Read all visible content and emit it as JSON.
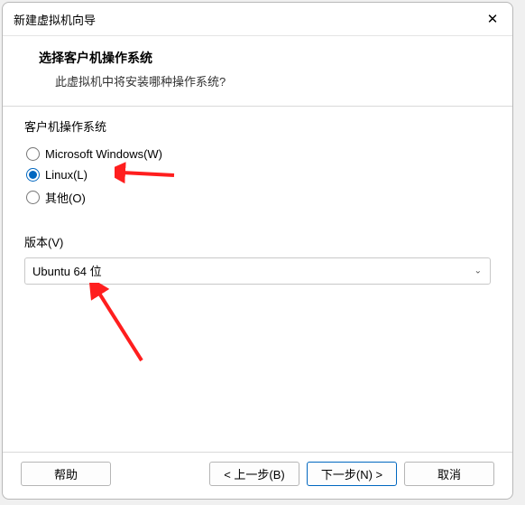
{
  "window": {
    "title": "新建虚拟机向导"
  },
  "header": {
    "heading": "选择客户机操作系统",
    "subheading": "此虚拟机中将安装哪种操作系统?"
  },
  "os_group": {
    "label": "客户机操作系统",
    "options": [
      {
        "label": "Microsoft Windows(W)",
        "checked": false
      },
      {
        "label": "Linux(L)",
        "checked": true
      },
      {
        "label": "其他(O)",
        "checked": false
      }
    ]
  },
  "version": {
    "label": "版本(V)",
    "selected": "Ubuntu 64 位"
  },
  "buttons": {
    "help": "帮助",
    "back": "< 上一步(B)",
    "next": "下一步(N) >",
    "cancel": "取消"
  },
  "annotations": {
    "arrow_color": "#ff1e1e"
  }
}
